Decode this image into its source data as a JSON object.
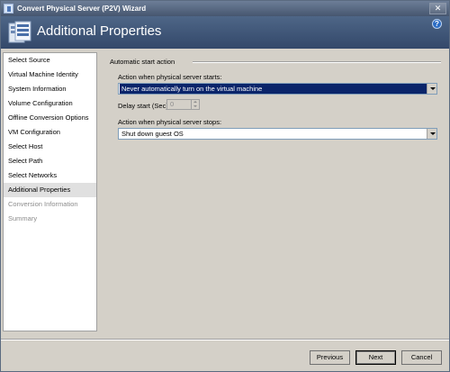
{
  "window": {
    "title": "Convert Physical Server (P2V) Wizard",
    "close_glyph": "✕"
  },
  "header": {
    "title": "Additional Properties",
    "help_glyph": "?"
  },
  "sidebar": {
    "items": [
      {
        "label": "Select Source",
        "state": "normal"
      },
      {
        "label": "Virtual Machine Identity",
        "state": "normal"
      },
      {
        "label": "System Information",
        "state": "normal"
      },
      {
        "label": "Volume Configuration",
        "state": "normal"
      },
      {
        "label": "Offline Conversion Options",
        "state": "normal"
      },
      {
        "label": "VM Configuration",
        "state": "normal"
      },
      {
        "label": "Select Host",
        "state": "normal"
      },
      {
        "label": "Select Path",
        "state": "normal"
      },
      {
        "label": "Select Networks",
        "state": "normal"
      },
      {
        "label": "Additional Properties",
        "state": "active"
      },
      {
        "label": "Conversion Information",
        "state": "disabled"
      },
      {
        "label": "Summary",
        "state": "disabled"
      }
    ]
  },
  "content": {
    "group_title": "Automatic start action",
    "start_label": "Action when physical server starts:",
    "start_value": "Never automatically turn on the virtual machine",
    "delay_label": "Delay start (Sec):",
    "delay_value": "0",
    "stop_label": "Action when physical server stops:",
    "stop_value": "Shut down guest OS"
  },
  "buttons": {
    "previous": "Previous",
    "next": "Next",
    "cancel": "Cancel"
  },
  "colors": {
    "header_bg": "#3f5679",
    "selection": "#0a246a"
  }
}
